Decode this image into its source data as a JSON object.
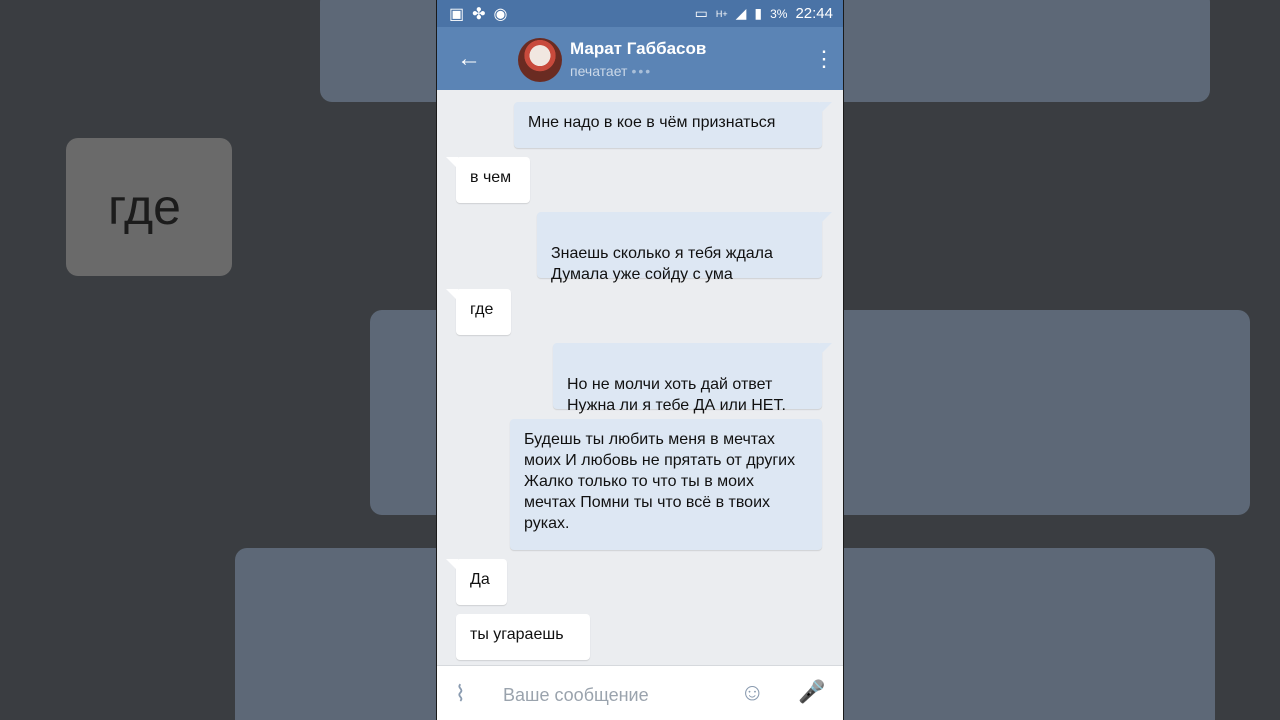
{
  "status_bar": {
    "battery": "3%",
    "time": "22:44",
    "network": "H+"
  },
  "header": {
    "contact_name": "Марат Габбасов",
    "status": "печатает",
    "status_dots": "•••"
  },
  "messages": [
    {
      "direction": "out",
      "text": "Мне надо в кое в чём признаться"
    },
    {
      "direction": "in",
      "text": "в чем"
    },
    {
      "direction": "out",
      "text": "Знаешь сколько я тебя ждала\nДумала уже сойду с ума"
    },
    {
      "direction": "in",
      "text": "где"
    },
    {
      "direction": "out",
      "text": "Но не молчи хоть дай ответ\nНужна ли я тебе ДА или НЕТ."
    },
    {
      "direction": "out",
      "text": "Будешь ты любить меня в мечтах моих И любовь не прятать от других Жалко только то что ты в моих мечтах Помни ты что всё в твоих руках."
    },
    {
      "direction": "in",
      "text": "Да"
    },
    {
      "direction": "in",
      "text": "ты угараешь"
    }
  ],
  "input": {
    "placeholder": "Ваше сообщение"
  },
  "colors": {
    "status_bar": "#4a73a6",
    "app_bar": "#5b84b5",
    "outgoing_bubble": "#dde7f3",
    "incoming_bubble": "#ffffff",
    "chat_background": "#ebedf0"
  }
}
